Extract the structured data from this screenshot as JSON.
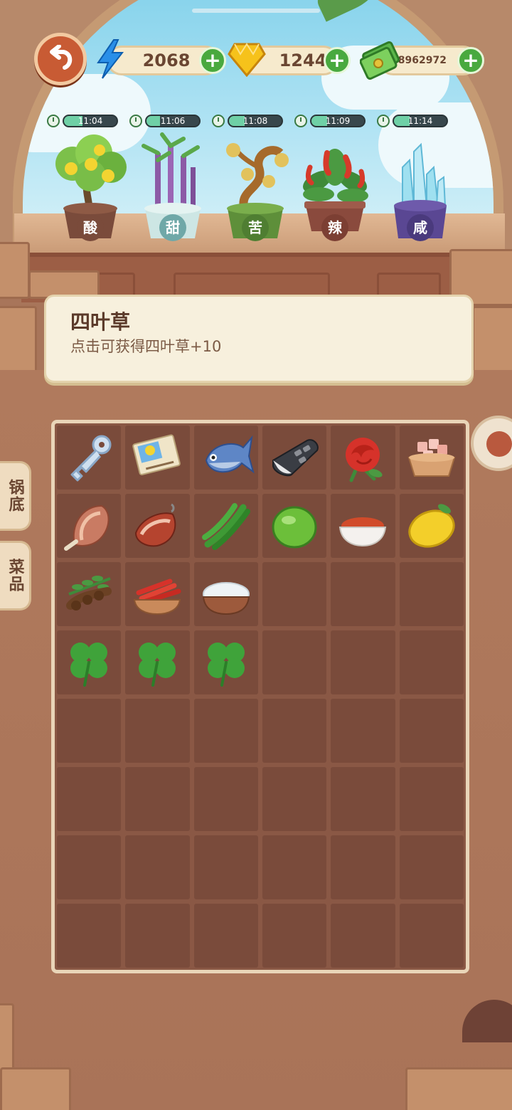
{
  "hud": {
    "energy": "2068",
    "gems": "1244",
    "cash": "88962972"
  },
  "plants": [
    {
      "label": "酸",
      "time": "11:04",
      "progress": 0.35
    },
    {
      "label": "甜",
      "time": "11:06",
      "progress": 0.25
    },
    {
      "label": "苦",
      "time": "11:08",
      "progress": 0.3
    },
    {
      "label": "辣",
      "time": "11:09",
      "progress": 0.3
    },
    {
      "label": "咸",
      "time": "11:14",
      "progress": 0.3
    }
  ],
  "tooltip": {
    "title": "四叶草",
    "description": "点击可获得四叶草+10"
  },
  "side_tabs": {
    "pot_base": "锅底",
    "dishes": "菜品"
  },
  "inventory": [
    "key-icon",
    "card-icon",
    "fish-icon",
    "car-key-icon",
    "rose-icon",
    "ham-bowl-icon",
    "meat-icon",
    "bacon-icon",
    "green-pepper-icon",
    "lime-icon",
    "chili-powder-icon",
    "lemon-icon",
    "tamarind-icon",
    "red-chili-bowl-icon",
    "salt-bowl-icon",
    "empty",
    "empty",
    "empty",
    "clover-icon",
    "clover-icon",
    "clover-icon",
    "empty",
    "empty",
    "empty"
  ],
  "colors": {
    "accent_green": "#49a93f",
    "back_button": "#c85b34",
    "tooltip_bg": "#f7f0dd"
  }
}
